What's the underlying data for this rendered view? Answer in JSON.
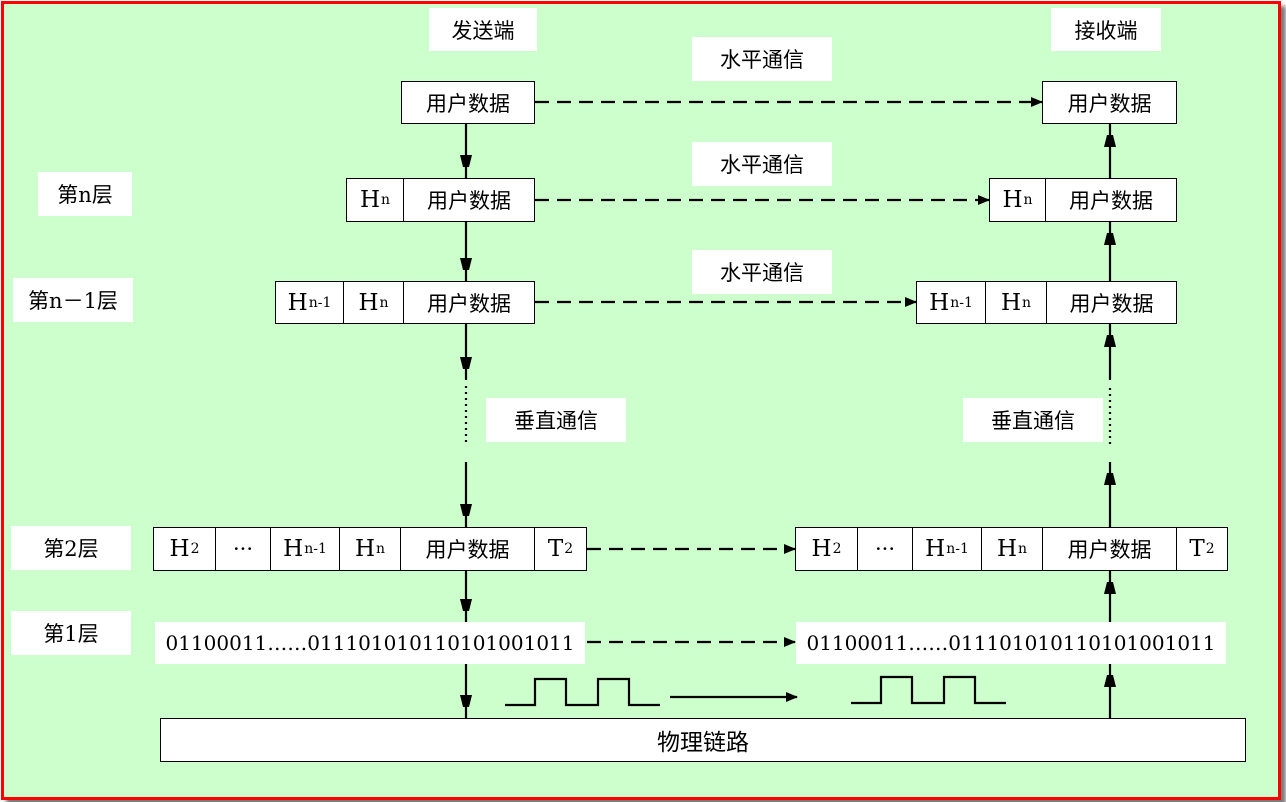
{
  "sender_title": "发送端",
  "receiver_title": "接收端",
  "horizontal_comm": "水平通信",
  "vertical_comm": "垂直通信",
  "layers": {
    "n": "第n层",
    "n_minus_1": "第n－1层",
    "l2": "第2层",
    "l1": "第1层"
  },
  "user_data": "用户数据",
  "ellipsis": "···",
  "headers": {
    "h": "H",
    "n": "n",
    "n1": "n-1",
    "two": "2",
    "t": "T"
  },
  "bits": "01100011……011101010110101001011",
  "physical_link": "物理链路"
}
